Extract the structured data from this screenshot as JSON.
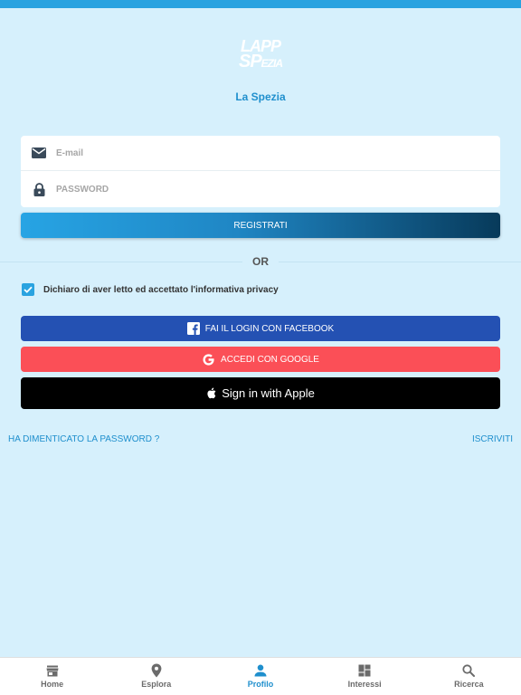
{
  "logo": {
    "line1": "LAPP",
    "line2a": "SP",
    "line2b": "EZIA"
  },
  "city": "La Spezia",
  "form": {
    "email_placeholder": "E-mail",
    "password_placeholder": "PASSWORD",
    "register_label": "REGISTRATI"
  },
  "divider_label": "OR",
  "privacy": {
    "checked": true,
    "label": "Dichiaro di aver letto ed accettato l'informativa privacy"
  },
  "social": {
    "facebook_label": "FAI IL LOGIN CON FACEBOOK",
    "google_label": "ACCEDI CON GOOGLE",
    "apple_label": "Sign in with Apple"
  },
  "links": {
    "forgot": "HA DIMENTICATO LA PASSWORD ?",
    "signup": "ISCRIVITI"
  },
  "tabs": [
    {
      "label": "Home",
      "icon": "store-icon",
      "active": false
    },
    {
      "label": "Esplora",
      "icon": "location-pin-icon",
      "active": false
    },
    {
      "label": "Profilo",
      "icon": "person-icon",
      "active": true
    },
    {
      "label": "Interessi",
      "icon": "dashboard-icon",
      "active": false
    },
    {
      "label": "Ricerca",
      "icon": "search-icon",
      "active": false
    }
  ],
  "colors": {
    "background": "#d6f0fc",
    "accent": "#1f8fcd",
    "facebook": "#2451b3",
    "google": "#fb4f57",
    "apple": "#000000"
  }
}
